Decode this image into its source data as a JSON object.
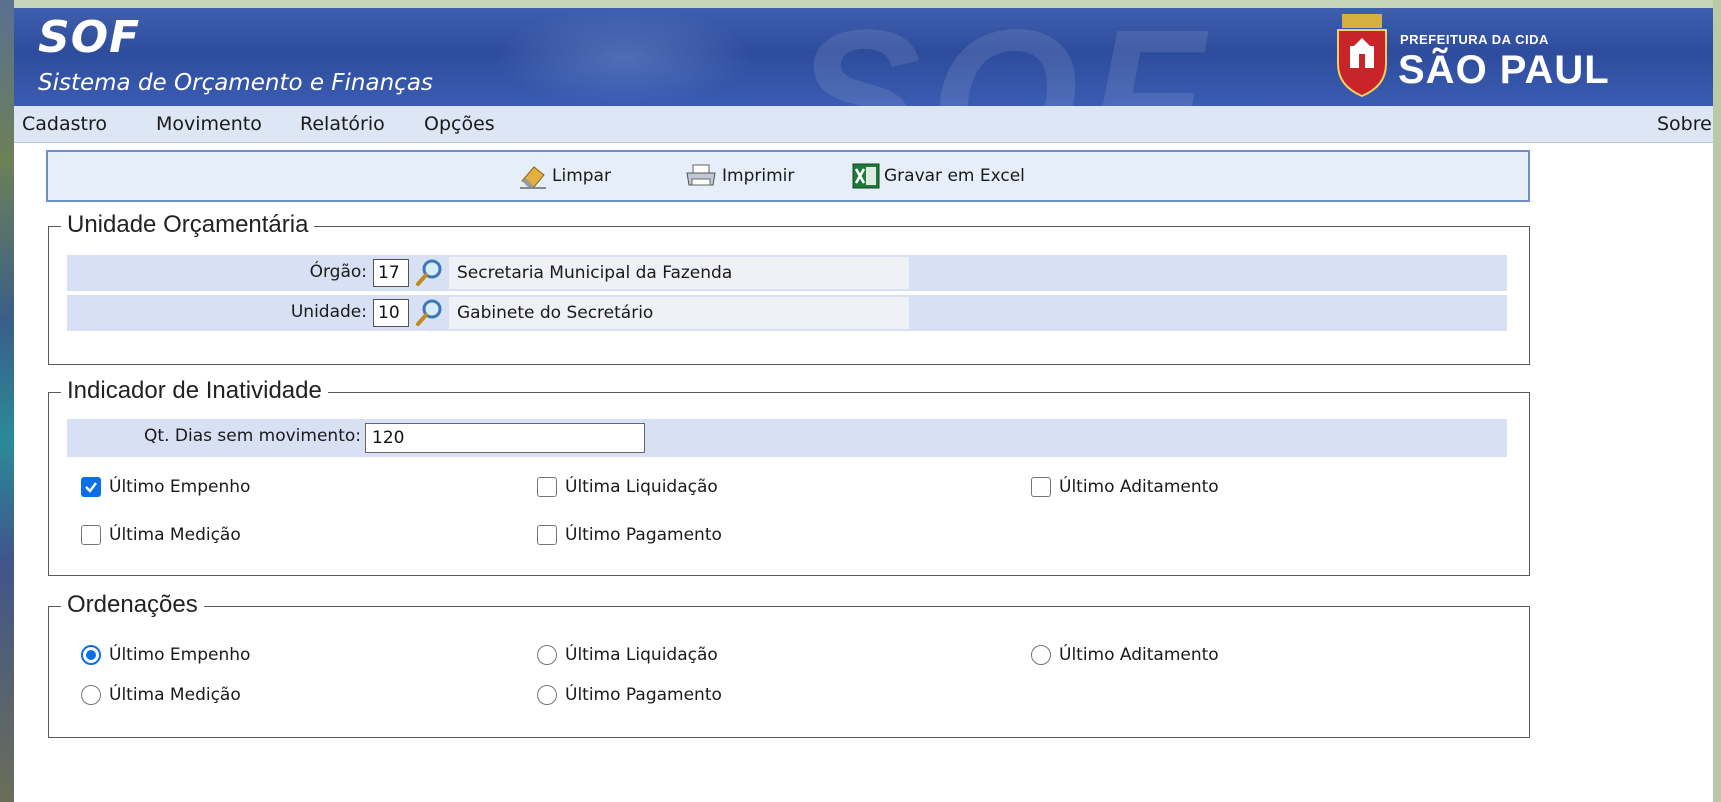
{
  "header": {
    "app_title": "SOF",
    "app_subtitle": "Sistema de Orçamento e Finanças",
    "logo_line1": "PREFEITURA DA CIDA",
    "logo_line2": "SÃO PAUL"
  },
  "menu": {
    "items": [
      "Cadastro",
      "Movimento",
      "Relatório",
      "Opções"
    ],
    "about": "Sobre"
  },
  "toolbar": {
    "clear_label": "Limpar",
    "print_label": "Imprimir",
    "excel_label": "Gravar em Excel"
  },
  "unidade": {
    "legend": "Unidade Orçamentária",
    "orgao_label": "Órgão:",
    "orgao_code": "17",
    "orgao_name": "Secretaria Municipal da Fazenda",
    "unidade_label": "Unidade:",
    "unidade_code": "10",
    "unidade_name": "Gabinete do Secretário"
  },
  "inatividade": {
    "legend": "Indicador de Inatividade",
    "days_label": "Qt. Dias sem movimento:",
    "days_value": "120",
    "options": [
      {
        "label": "Último Empenho",
        "checked": true
      },
      {
        "label": "Última Liquidação",
        "checked": false
      },
      {
        "label": "Último Aditamento",
        "checked": false
      },
      {
        "label": "Última Medição",
        "checked": false
      },
      {
        "label": "Último Pagamento",
        "checked": false
      }
    ]
  },
  "ordenacoes": {
    "legend": "Ordenações",
    "selected": "Último Empenho",
    "options": [
      {
        "label": "Último Empenho"
      },
      {
        "label": "Última Liquidação"
      },
      {
        "label": "Último Aditamento"
      },
      {
        "label": "Última Medição"
      },
      {
        "label": "Último Pagamento"
      }
    ]
  },
  "colors": {
    "banner": "#2e4c9c",
    "menubar": "#dce6f4",
    "band": "#d8e0f4",
    "accent": "#0b6fe8"
  }
}
